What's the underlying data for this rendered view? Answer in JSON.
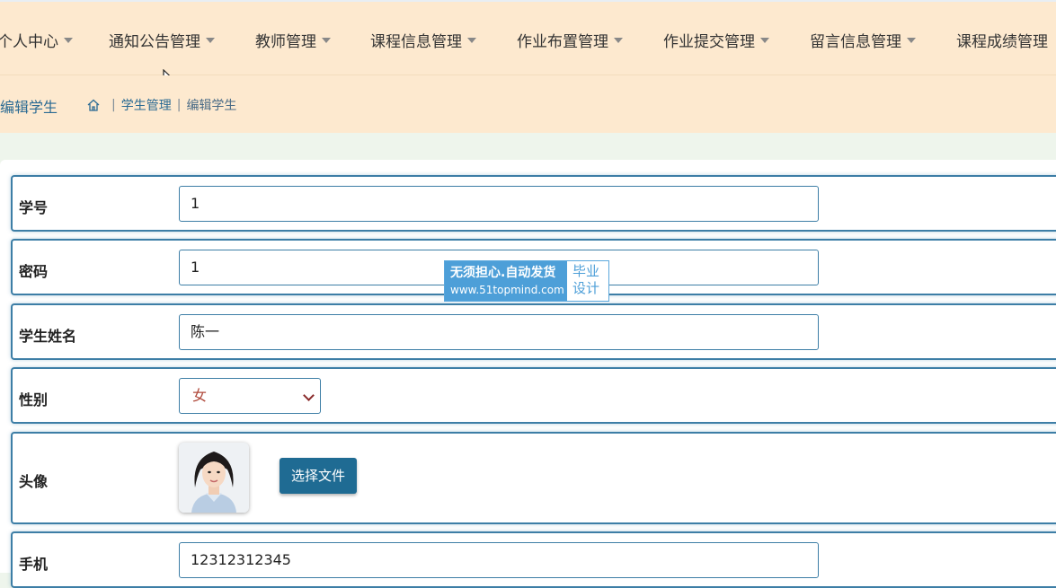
{
  "nav": {
    "items": [
      {
        "label": "个人中心",
        "has_caret": true
      },
      {
        "label": "通知公告管理",
        "has_caret": true
      },
      {
        "label": "教师管理",
        "has_caret": true
      },
      {
        "label": "课程信息管理",
        "has_caret": true
      },
      {
        "label": "作业布置管理",
        "has_caret": true
      },
      {
        "label": "作业提交管理",
        "has_caret": true
      },
      {
        "label": "留言信息管理",
        "has_caret": true
      },
      {
        "label": "课程成绩管理",
        "has_caret": false
      }
    ]
  },
  "breadcrumb": {
    "page_title": "编辑学生",
    "home_icon": "home-icon",
    "separator": "|",
    "parent": "学生管理",
    "current": "编辑学生"
  },
  "form": {
    "student_id": {
      "label": "学号",
      "value": "1"
    },
    "password": {
      "label": "密码",
      "value": "1"
    },
    "student_name": {
      "label": "学生姓名",
      "value": "陈一"
    },
    "gender": {
      "label": "性别",
      "value": "女"
    },
    "avatar": {
      "label": "头像",
      "button_label": "选择文件"
    },
    "phone": {
      "label": "手机",
      "value": "12312312345"
    }
  },
  "watermark": {
    "line1": "无须担心.自动发货",
    "line2": "www.51topmind.com",
    "right1": "毕业",
    "right2": "设计"
  },
  "colors": {
    "nav_bg": "#fde9cf",
    "page_bg": "#eef5ec",
    "accent": "#3d7ea6",
    "button": "#1f6b93"
  }
}
